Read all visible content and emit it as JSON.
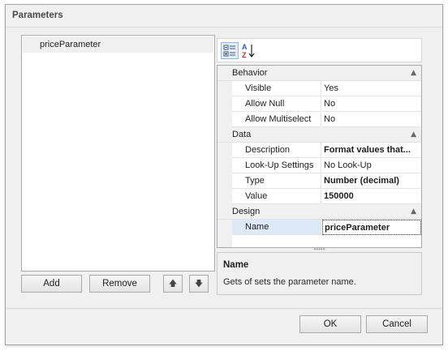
{
  "window": {
    "title": "Parameters"
  },
  "parameters": {
    "items": [
      "priceParameter"
    ]
  },
  "list_buttons": {
    "add": "Add",
    "remove": "Remove",
    "up_icon": "arrow-up-icon",
    "down_icon": "arrow-down-icon"
  },
  "toolbar": {
    "categorized_icon": "categorized-view-icon",
    "alphabetical_icon": "sort-az-icon",
    "alpha_glyph_a": "A",
    "alpha_glyph_z": "Z"
  },
  "property_grid": {
    "categories": [
      {
        "name": "Behavior",
        "rows": [
          {
            "name": "Visible",
            "value": "Yes",
            "bold": false
          },
          {
            "name": "Allow Null",
            "value": "No",
            "bold": false
          },
          {
            "name": "Allow Multiselect",
            "value": "No",
            "bold": false
          }
        ]
      },
      {
        "name": "Data",
        "rows": [
          {
            "name": "Description",
            "value": "Format values that...",
            "bold": true
          },
          {
            "name": "Look-Up Settings",
            "value": "No Look-Up",
            "bold": false
          },
          {
            "name": "Type",
            "value": "Number (decimal)",
            "bold": true
          },
          {
            "name": "Value",
            "value": "150000",
            "bold": true
          }
        ]
      },
      {
        "name": "Design",
        "rows": [
          {
            "name": "Name",
            "value": "priceParameter",
            "bold": true,
            "selected": true
          }
        ]
      }
    ]
  },
  "description": {
    "title": "Name",
    "text": "Gets of sets the parameter name."
  },
  "footer": {
    "ok": "OK",
    "cancel": "Cancel"
  }
}
